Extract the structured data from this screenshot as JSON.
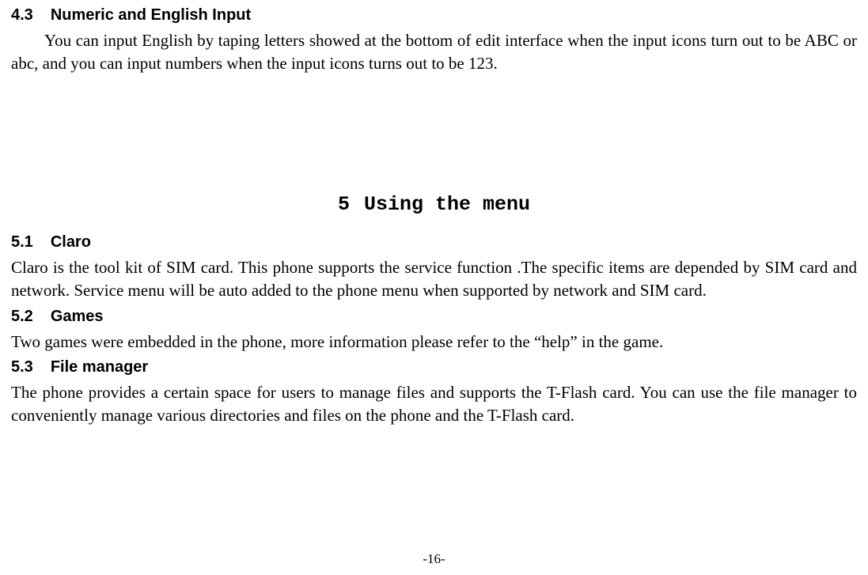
{
  "section43": {
    "num": "4.3",
    "title": "Numeric and English Input",
    "body": "You can input English by taping letters showed at the bottom of edit interface when the input icons turn out to be ABC or abc, and you can input numbers when the input icons turns out to be 123."
  },
  "chapter5": {
    "num": "5",
    "title": "Using the menu"
  },
  "section51": {
    "num": "5.1",
    "title": "Claro",
    "body": "Claro is the tool kit of SIM card. This phone supports the service function .The specific items are depended by SIM card and network. Service menu will be auto added to the phone menu when supported by network and SIM card."
  },
  "section52": {
    "num": "5.2",
    "title": "Games",
    "body": "Two games were embedded in the phone, more information please refer to the “help” in the game."
  },
  "section53": {
    "num": "5.3",
    "title": "File manager",
    "body": "The phone provides a certain space for users to manage files and supports the T-Flash card. You can use the file manager to conveniently manage various directories and files on the phone and the T-Flash card."
  },
  "pageNumber": "-16-"
}
